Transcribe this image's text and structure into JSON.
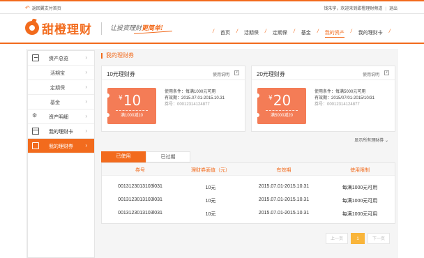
{
  "topbar": {
    "back_label": "返回翼支付首页",
    "greeting": "钱朱宇，欢迎来到甜橙理财频道",
    "logout": "退出"
  },
  "header": {
    "logo_text": "甜橙理财",
    "slogan_prefix": "让投资理财",
    "slogan_emph": "更简单!",
    "nav": [
      "首页",
      "活期保",
      "定期保",
      "基金",
      "我的资产",
      "我的理财卡"
    ],
    "active_nav": "我的资产"
  },
  "sidebar": {
    "items": [
      {
        "label": "资产总览",
        "icon": "asset-overview-icon"
      },
      {
        "label": "活期宝",
        "icon": ""
      },
      {
        "label": "定期保",
        "icon": ""
      },
      {
        "label": "基金",
        "icon": ""
      },
      {
        "label": "资产明细",
        "icon": "asset-detail-icon"
      },
      {
        "label": "我的理财卡",
        "icon": "card-icon"
      },
      {
        "label": "我的理财券",
        "icon": "coupon-icon"
      }
    ],
    "active": "我的理财券"
  },
  "main": {
    "section_title": "我的理财券",
    "cards": [
      {
        "title": "10元理财券",
        "help": "使用说明",
        "amount": "10",
        "currency": "¥",
        "condition_short": "满1000减10",
        "condition": "使用条件：每满1000元可用",
        "validity": "有效期：2015.07.01-2015.10.31",
        "code": "券号：00012314124877"
      },
      {
        "title": "20元理财券",
        "help": "使用说明",
        "amount": "20",
        "currency": "¥",
        "condition_short": "满5000减20",
        "condition": "使用条件：每满5000元可用",
        "validity": "有效期：2015/07/01-2015/10/31",
        "code": "券号：00012314124877"
      }
    ],
    "show_all": "显示所有理财券",
    "tabs": [
      "已使用",
      "已过期"
    ],
    "table": {
      "headers": [
        "券号",
        "理财券面值（元）",
        "有效期",
        "使用限制"
      ],
      "rows": [
        [
          "0013123013103l031",
          "10元",
          "2015.07.01-2015.10.31",
          "每满1000元可用"
        ],
        [
          "0013123013103l031",
          "10元",
          "2015.07.01-2015.10.31",
          "每满1000元可用"
        ],
        [
          "0013123013103l031",
          "10元",
          "2015.07.01-2015.10.31",
          "每满1000元可用"
        ]
      ]
    },
    "pager": {
      "prev": "上一页",
      "current": "1",
      "next": "下一页"
    }
  },
  "colors": {
    "accent": "#f26b1d",
    "coupon": "#f47c56",
    "pager_active": "#f9b53b"
  }
}
